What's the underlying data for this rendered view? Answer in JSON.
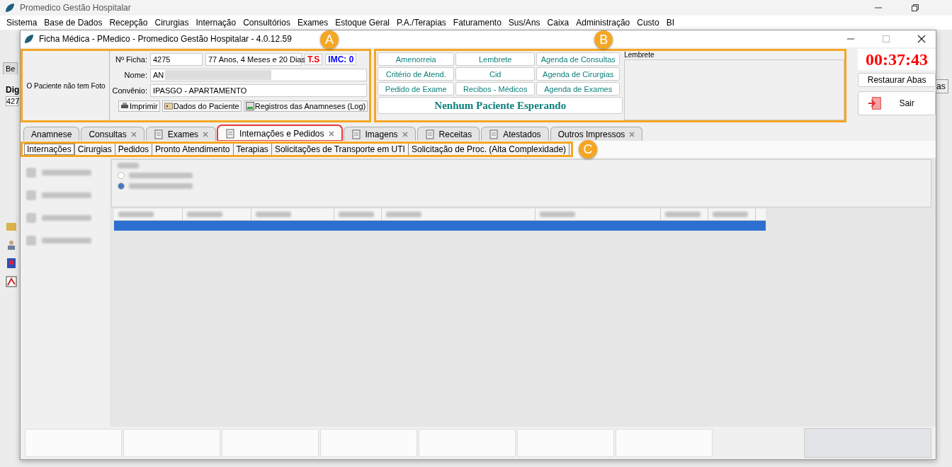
{
  "app": {
    "title": "Promedico Gestão Hospitalar",
    "menu": [
      "Sistema",
      "Base de Dados",
      "Recepção",
      "Cirurgias",
      "Internação",
      "Consultórios",
      "Exames",
      "Estoque Geral",
      "P.A./Terapias",
      "Faturamento",
      "Sus/Ans",
      "Caixa",
      "Administração",
      "Custo",
      "BI"
    ]
  },
  "background_window": {
    "tab": "Be",
    "label": "Dig",
    "field": "427",
    "button": "as"
  },
  "window": {
    "title": "Ficha Médica - PMedico - Promedico Gestão Hospitalar - 4.0.12.59"
  },
  "patient": {
    "photo": "O Paciente não tem Foto",
    "ficha_label": "Nº Ficha:",
    "ficha": "4275",
    "age": "77 Anos, 4 Meses e 20 Dias",
    "ts": "T.S",
    "imc": "IMC: 0",
    "name_label": "Nome:",
    "name": "AN",
    "convenio_label": "Convênio:",
    "convenio": "IPASGO - APARTAMENTO",
    "actions": [
      "Imprimir",
      "Dados do Paciente",
      "Registros das Anamneses (Log)"
    ]
  },
  "shortcuts": [
    "Amenorreia",
    "Lembrete",
    "Agenda de Consultas",
    "Critério de Atend.",
    "Cid",
    "Agenda de Cirurgias",
    "Pedido de Exame",
    "Recibos - Médicos",
    "Agenda de Exames"
  ],
  "waiting": "Nenhum Paciente Esperando",
  "reminder": {
    "label": "Lembrete"
  },
  "timer": "00:37:43",
  "restore_button": "Restaurar Abas",
  "exit_button": "Sair",
  "annotations": [
    "A",
    "B",
    "C"
  ],
  "tabs": [
    {
      "label": "Anamnese",
      "selected": false,
      "closable": false,
      "icon": false
    },
    {
      "label": "Consultas",
      "selected": false,
      "closable": true,
      "icon": false
    },
    {
      "label": "Exames",
      "selected": false,
      "closable": true,
      "icon": true
    },
    {
      "label": "Internações e Pedidos",
      "selected": true,
      "closable": true,
      "icon": true
    },
    {
      "label": "Imagens",
      "selected": false,
      "closable": true,
      "icon": true
    },
    {
      "label": "Receitas",
      "selected": false,
      "closable": false,
      "icon": true
    },
    {
      "label": "Atestados",
      "selected": false,
      "closable": false,
      "icon": true
    },
    {
      "label": "Outros Impressos",
      "selected": false,
      "closable": true,
      "icon": false
    }
  ],
  "filter_options": [
    {
      "selected": false
    },
    {
      "selected": true
    }
  ],
  "subtabs": [
    {
      "label": "Internações",
      "selected": true
    },
    {
      "label": "Cirurgias",
      "selected": false
    },
    {
      "label": "Pedidos",
      "selected": false
    },
    {
      "label": "Pronto Atendimento",
      "selected": false
    },
    {
      "label": "Terapias",
      "selected": false
    },
    {
      "label": "Solicitações de Transporte em UTI",
      "selected": false
    },
    {
      "label": "Solicitação de Proc. (Alta Complexidade)",
      "selected": false
    }
  ]
}
